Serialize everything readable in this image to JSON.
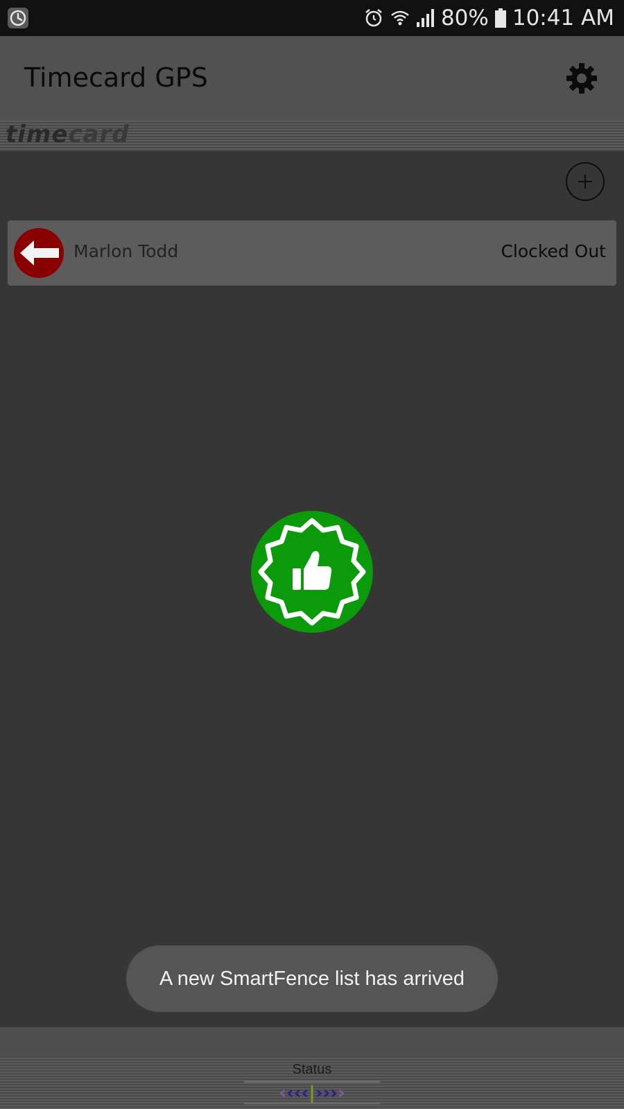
{
  "status_bar": {
    "battery": "80%",
    "time": "10:41 AM",
    "left_icon": "clock-icon",
    "icons": [
      "alarm-icon",
      "wifi-icon",
      "cell-signal-icon",
      "battery-icon"
    ]
  },
  "app_bar": {
    "title": "Timecard GPS",
    "settings_icon": "gear-icon"
  },
  "brand": {
    "logo_part1": "time",
    "logo_part2": "card"
  },
  "employees": [
    {
      "name": "Marlon Todd",
      "status": "Clocked Out",
      "status_icon": "arrow-left-icon",
      "status_color": "#8a0000"
    }
  ],
  "success_badge": {
    "icon": "thumbs-up-icon",
    "color": "#0a9a0a"
  },
  "toast": {
    "message": "A new SmartFence list has arrived"
  },
  "bottom_bar": {
    "status_label": "Status"
  }
}
